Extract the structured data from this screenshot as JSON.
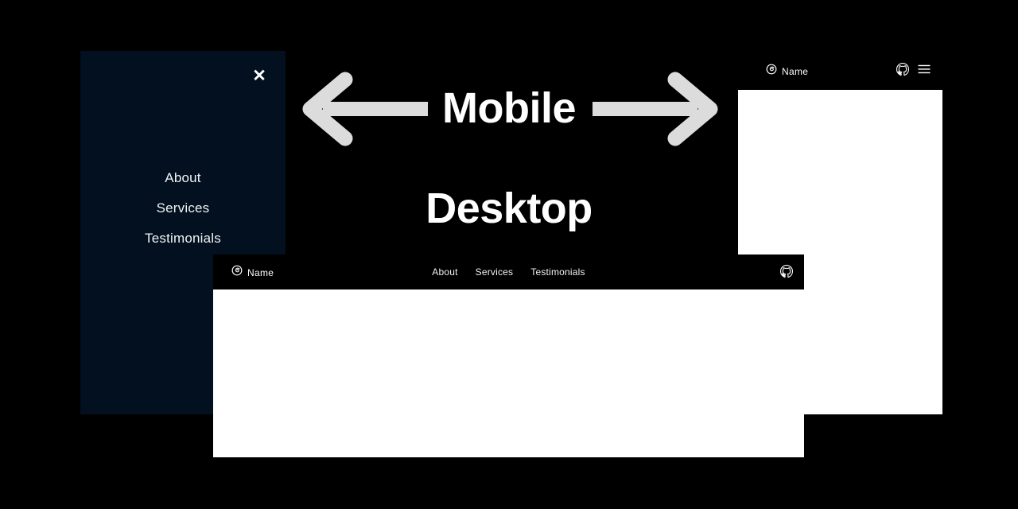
{
  "page": {
    "background_color": "#000000",
    "annotation_text_color": "#ffffff",
    "arrow_color": "#dcdcdc"
  },
  "annotations": {
    "mobile_label": "Mobile",
    "desktop_label": "Desktop",
    "left_arrow_icon": "arrow-left-icon",
    "right_arrow_icon": "arrow-right-icon"
  },
  "mobile_drawer": {
    "background_color": "#02101f",
    "close_label": "✕",
    "close_icon": "close-icon",
    "links": [
      {
        "label": "About"
      },
      {
        "label": "Services"
      },
      {
        "label": "Testimonials"
      }
    ]
  },
  "mobile_viewport": {
    "navbar": {
      "background_color": "#000000",
      "brand": {
        "icon": "swirl-logo-icon",
        "label": "Name"
      },
      "actions": [
        {
          "icon": "github-icon",
          "label": "GitHub"
        },
        {
          "icon": "hamburger-menu-icon",
          "label": "Menu"
        }
      ]
    },
    "content_background_color": "#ffffff"
  },
  "desktop_viewport": {
    "navbar": {
      "background_color": "#000000",
      "brand": {
        "icon": "swirl-logo-icon",
        "label": "Name"
      },
      "links": [
        {
          "label": "About"
        },
        {
          "label": "Services"
        },
        {
          "label": "Testimonials"
        }
      ],
      "actions": [
        {
          "icon": "github-icon",
          "label": "GitHub"
        }
      ]
    },
    "content_background_color": "#ffffff"
  }
}
